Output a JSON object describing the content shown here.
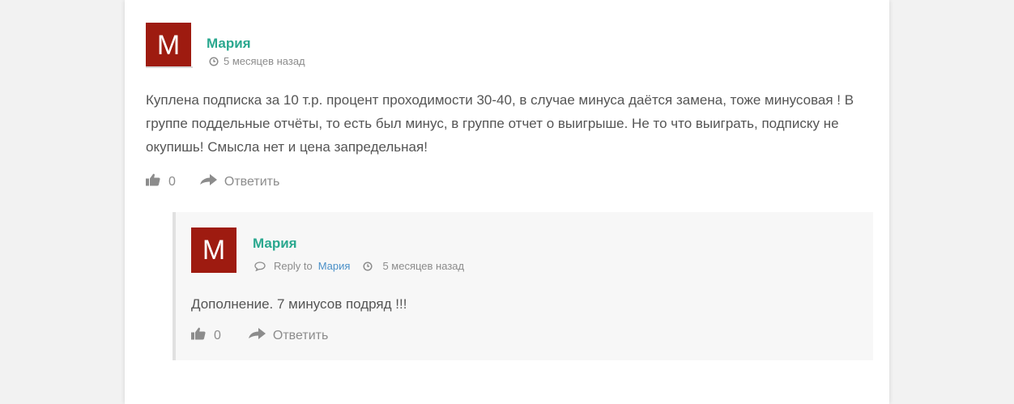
{
  "comment": {
    "avatar_letter": "М",
    "author": "Мария",
    "time": "5 месяцев назад",
    "text": "Куплена подписка за 10 т.р. процент проходимости 30-40, в случае минуса даётся замена, тоже минусовая ! В группе поддельные отчёты, то есть был минус, в группе отчет о выигрыше. Не то что выиграть, подписку не окупишь! Смысла нет и цена запредельная!",
    "likes": "0",
    "reply_label": "Ответить"
  },
  "reply": {
    "avatar_letter": "М",
    "author": "Мария",
    "reply_to_label": "Reply to",
    "reply_to_name": "Мария",
    "time": "5 месяцев назад",
    "text": "Дополнение. 7 минусов подряд !!!",
    "likes": "0",
    "reply_label": "Ответить"
  },
  "colors": {
    "avatar": "#9e1b10",
    "author": "#2aa88f",
    "link": "#4a90c8"
  }
}
